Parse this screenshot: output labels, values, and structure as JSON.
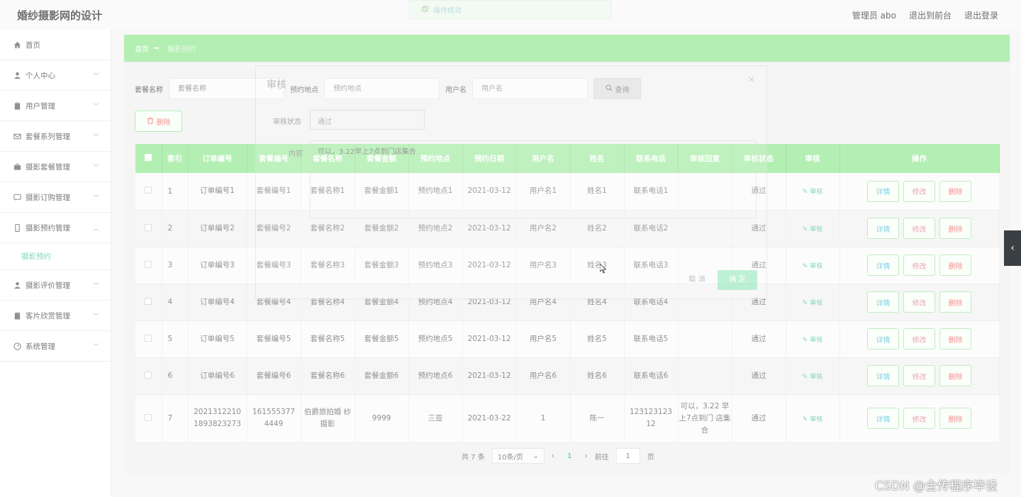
{
  "header": {
    "brand": "婚纱摄影网的设计",
    "admin": "管理员 abo",
    "to_front": "退出到前台",
    "logout": "退出登录"
  },
  "sidebar": {
    "items": [
      {
        "label": "首页",
        "icon": "home-icon"
      },
      {
        "label": "个人中心",
        "icon": "user-icon"
      },
      {
        "label": "用户管理",
        "icon": "clipboard-icon"
      },
      {
        "label": "套餐系列管理",
        "icon": "mail-icon"
      },
      {
        "label": "摄影套餐管理",
        "icon": "briefcase-icon"
      },
      {
        "label": "摄影订购管理",
        "icon": "chat-icon"
      },
      {
        "label": "摄影预约管理",
        "icon": "phone-icon"
      },
      {
        "label": "摄影评价管理",
        "icon": "user-icon"
      },
      {
        "label": "客片欣赏管理",
        "icon": "clipboard-icon"
      },
      {
        "label": "系统管理",
        "icon": "gauge-icon"
      }
    ],
    "sub_active": "摄影预约"
  },
  "breadcrumb": {
    "home": "首页",
    "arrow": "→",
    "current": "摄影预约"
  },
  "search": {
    "package_label": "套餐名称",
    "package_placeholder": "套餐名称",
    "place_label": "预约地点",
    "place_placeholder": "预约地点",
    "user_label": "用户名",
    "user_placeholder": "用户名",
    "query_label": "查询"
  },
  "delete_label": "删除",
  "table": {
    "headers": [
      "索引",
      "订单编号",
      "套餐编号",
      "套餐名称",
      "套餐金额",
      "预约地点",
      "预约日期",
      "用户名",
      "姓名",
      "联系电话",
      "审核回复",
      "审核状态",
      "审核",
      "操作"
    ],
    "audit_label": "审核",
    "ops": {
      "detail": "详情",
      "edit": "修改",
      "delete": "删除"
    },
    "rows": [
      [
        "1",
        "订单编号1",
        "套餐编号1",
        "套餐名称1",
        "套餐金额1",
        "预约地点1",
        "2021-03-12",
        "用户名1",
        "姓名1",
        "联系电话1",
        "",
        "通过"
      ],
      [
        "2",
        "订单编号2",
        "套餐编号2",
        "套餐名称2",
        "套餐金额2",
        "预约地点2",
        "2021-03-12",
        "用户名2",
        "姓名2",
        "联系电话2",
        "",
        "通过"
      ],
      [
        "3",
        "订单编号3",
        "套餐编号3",
        "套餐名称3",
        "套餐金额3",
        "预约地点3",
        "2021-03-12",
        "用户名3",
        "姓名3",
        "联系电话3",
        "",
        "通过"
      ],
      [
        "4",
        "订单编号4",
        "套餐编号4",
        "套餐名称4",
        "套餐金额4",
        "预约地点4",
        "2021-03-12",
        "用户名4",
        "姓名4",
        "联系电话4",
        "",
        "通过"
      ],
      [
        "5",
        "订单编号5",
        "套餐编号5",
        "套餐名称5",
        "套餐金额5",
        "预约地点5",
        "2021-03-12",
        "用户名5",
        "姓名5",
        "联系电话5",
        "",
        "通过"
      ],
      [
        "6",
        "订单编号6",
        "套餐编号6",
        "套餐名称6",
        "套餐金额6",
        "预约地点6",
        "2021-03-12",
        "用户名6",
        "姓名6",
        "联系电话6",
        "",
        "通过"
      ],
      [
        "7",
        "2021312210 1893823273",
        "161555377 4449",
        "伯爵旅拍婚 纱摄影",
        "9999",
        "三亚",
        "2021-03-22",
        "1",
        "陈一",
        "123123123 12",
        "可以，3.22 早上7点到门 店集合",
        "通过"
      ]
    ]
  },
  "pager": {
    "total": "共 7 条",
    "size": "10条/页",
    "prev": "‹",
    "current": "1",
    "next": "›",
    "goto": "前往",
    "goto_value": "1",
    "page_unit": "页"
  },
  "dialog": {
    "title": "审核",
    "close": "×",
    "status_label": "审核状态",
    "status_value": "通过",
    "content_label": "内容",
    "content_value": "可以，3.22早上7点到门店集合",
    "cancel": "取 消",
    "ok": "确 定"
  },
  "toast": "操作成功",
  "side_tab": "‹",
  "watermark": "CSDN @全传程序毕设"
}
